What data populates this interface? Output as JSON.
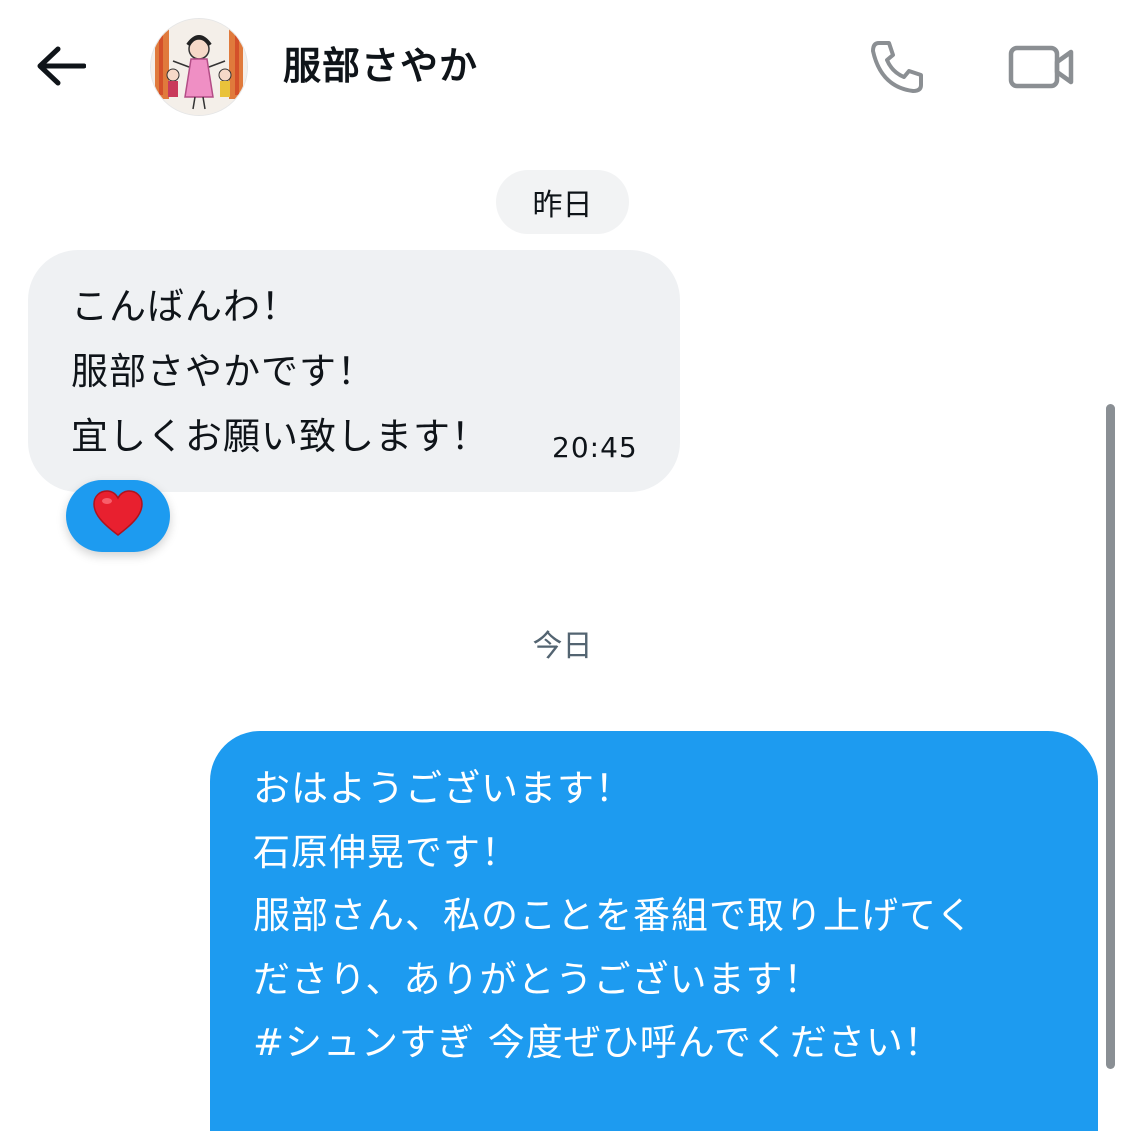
{
  "header": {
    "back_icon": "arrow-left-icon",
    "contact_name": "服部さやか",
    "avatar": "contact-avatar-drawing",
    "call_icon": "phone-icon",
    "video_icon": "video-camera-icon"
  },
  "separators": {
    "yesterday": "昨日",
    "today": "今日"
  },
  "incoming": {
    "lines": [
      "こんばんわ！",
      "服部さやかです！",
      "宜しくお願い致します！"
    ],
    "time": "20:45",
    "reaction": "❤️"
  },
  "outgoing": {
    "lines": [
      "おはようございます！",
      "石原伸晃です！",
      "服部さん、私のことを番組で取り上げてく",
      "ださり、ありがとうございます！",
      "#シュンすぎ 今度ぜひ呼んでください！"
    ]
  },
  "colors": {
    "accent": "#1d9bf0",
    "incoming_bubble": "#eff1f3",
    "icon_gray": "#8b8f93"
  }
}
